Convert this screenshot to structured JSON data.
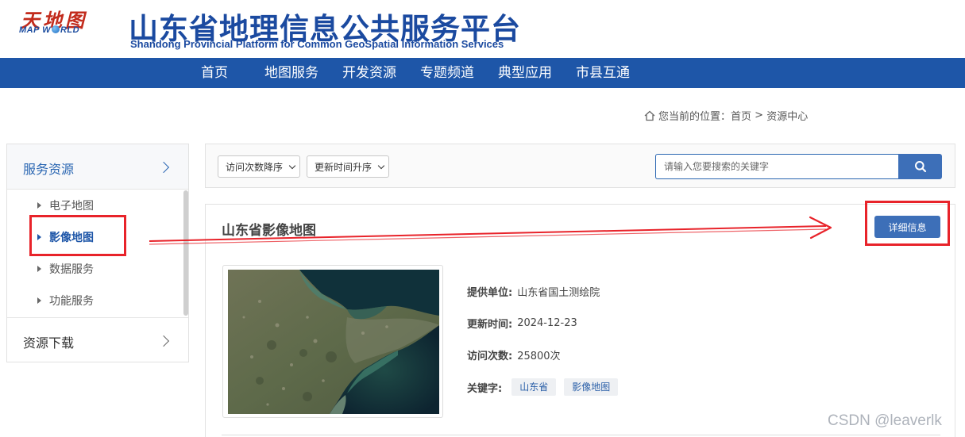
{
  "header": {
    "logo_cn": "天地图",
    "logo_en_pre": "MAP W",
    "logo_en_post": "RLD",
    "title": "山东省地理信息公共服务平台",
    "subtitle": "Shandong Provincial Platform for Common GeoSpatial Information Services"
  },
  "nav": {
    "items": [
      "首页",
      "地图服务",
      "开发资源",
      "专题频道",
      "典型应用",
      "市县互通"
    ]
  },
  "breadcrumb": {
    "prefix": "您当前的位置：",
    "home": "首页",
    "sep": " > ",
    "current": "资源中心"
  },
  "sidebar": {
    "section1": "服务资源",
    "items": [
      "电子地图",
      "影像地图",
      "数据服务",
      "功能服务"
    ],
    "active_index": 1,
    "section2": "资源下载"
  },
  "filters": {
    "sort_visits": "访问次数降序",
    "sort_time": "更新时间升序",
    "search_placeholder": "请输入您要搜索的关键字"
  },
  "card": {
    "title": "山东省影像地图",
    "detail_button": "详细信息",
    "provider_label": "提供单位:",
    "provider": "山东省国土测绘院",
    "updated_label": "更新时间:",
    "updated": "2024-12-23",
    "visits_label": "访问次数:",
    "visits": "25800次",
    "keywords_label": "关键字:",
    "keywords": [
      "山东省",
      "影像地图"
    ]
  },
  "annotation": {
    "color": "#e8232a"
  },
  "watermark": "CSDN @leaverlk",
  "colors": {
    "brand_blue": "#1e56a8",
    "button_blue": "#3d6fb8",
    "logo_red": "#c22b1c"
  }
}
